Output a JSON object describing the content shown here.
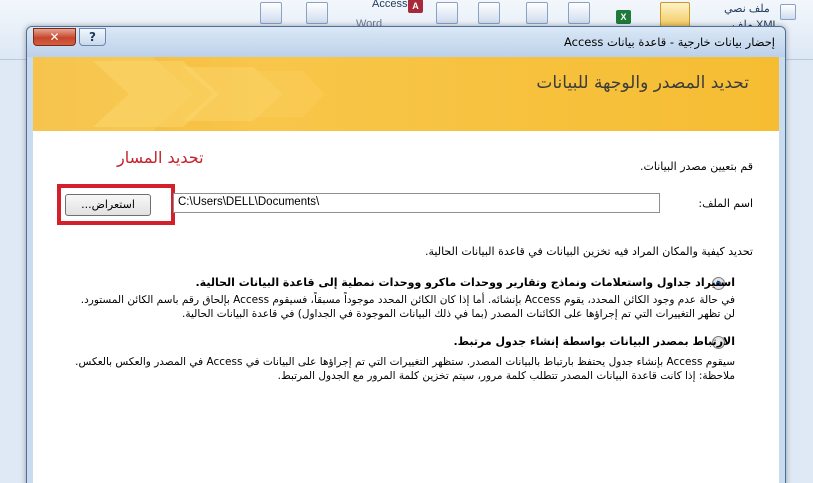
{
  "ribbon": {
    "access_label": "Access",
    "word_label": "Word",
    "text_file_label": "ملف نصي",
    "xml_file_label": "ملف XML"
  },
  "dialog": {
    "title": "إحضار بيانات خارجية - قاعدة بيانات Access",
    "close_glyph": "✕",
    "help_glyph": "?",
    "banner_title": "تحديد المصدر والوجهة للبيانات",
    "annotation": "تحديد المسار",
    "instruction": "قم بتعيين مصدر البيانات.",
    "file_name_label": "اسم الملف:",
    "file_path": "C:\\Users\\DELL\\Documents\\",
    "browse_label": "استعراض...",
    "storage_question": "تحديد كيفية والمكان المراد فيه تخزين البيانات في قاعدة البيانات الحالية.",
    "option_import": {
      "title": "استيراد جداول واستعلامات ونماذج وتقارير ووحدات ماكرو ووحدات نمطية إلى قاعدة البيانات الحالية.",
      "description": "في حالة عدم وجود الكائن المحدد، يقوم Access بإنشائه. أما إذا كان الكائن المحدد موجوداً مسبقاً، فسيقوم Access بإلحاق رقم باسم الكائن المستورد. لن تظهر التغييرات التي تم إجراؤها على الكائنات المصدر (بما في ذلك البيانات الموجودة في الجداول) في قاعدة البيانات الحالية.",
      "selected": true
    },
    "option_link": {
      "title": "الارتباط بمصدر البيانات بواسطة إنشاء جدول مرتبط.",
      "description": "سيقوم Access بإنشاء جدول يحتفظ بارتباط بالبيانات المصدر. ستظهر التغييرات التي تم إجراؤها على البيانات في Access في المصدر والعكس بالعكس. ملاحظة: إذا كانت قاعدة البيانات المصدر تتطلب كلمة مرور، سيتم تخزين كلمة المرور مع الجدول المرتبط.",
      "selected": false
    }
  },
  "colors": {
    "banner": "#f6bd32",
    "annotation_red": "#c7212b",
    "close_button": "#c6462d"
  }
}
